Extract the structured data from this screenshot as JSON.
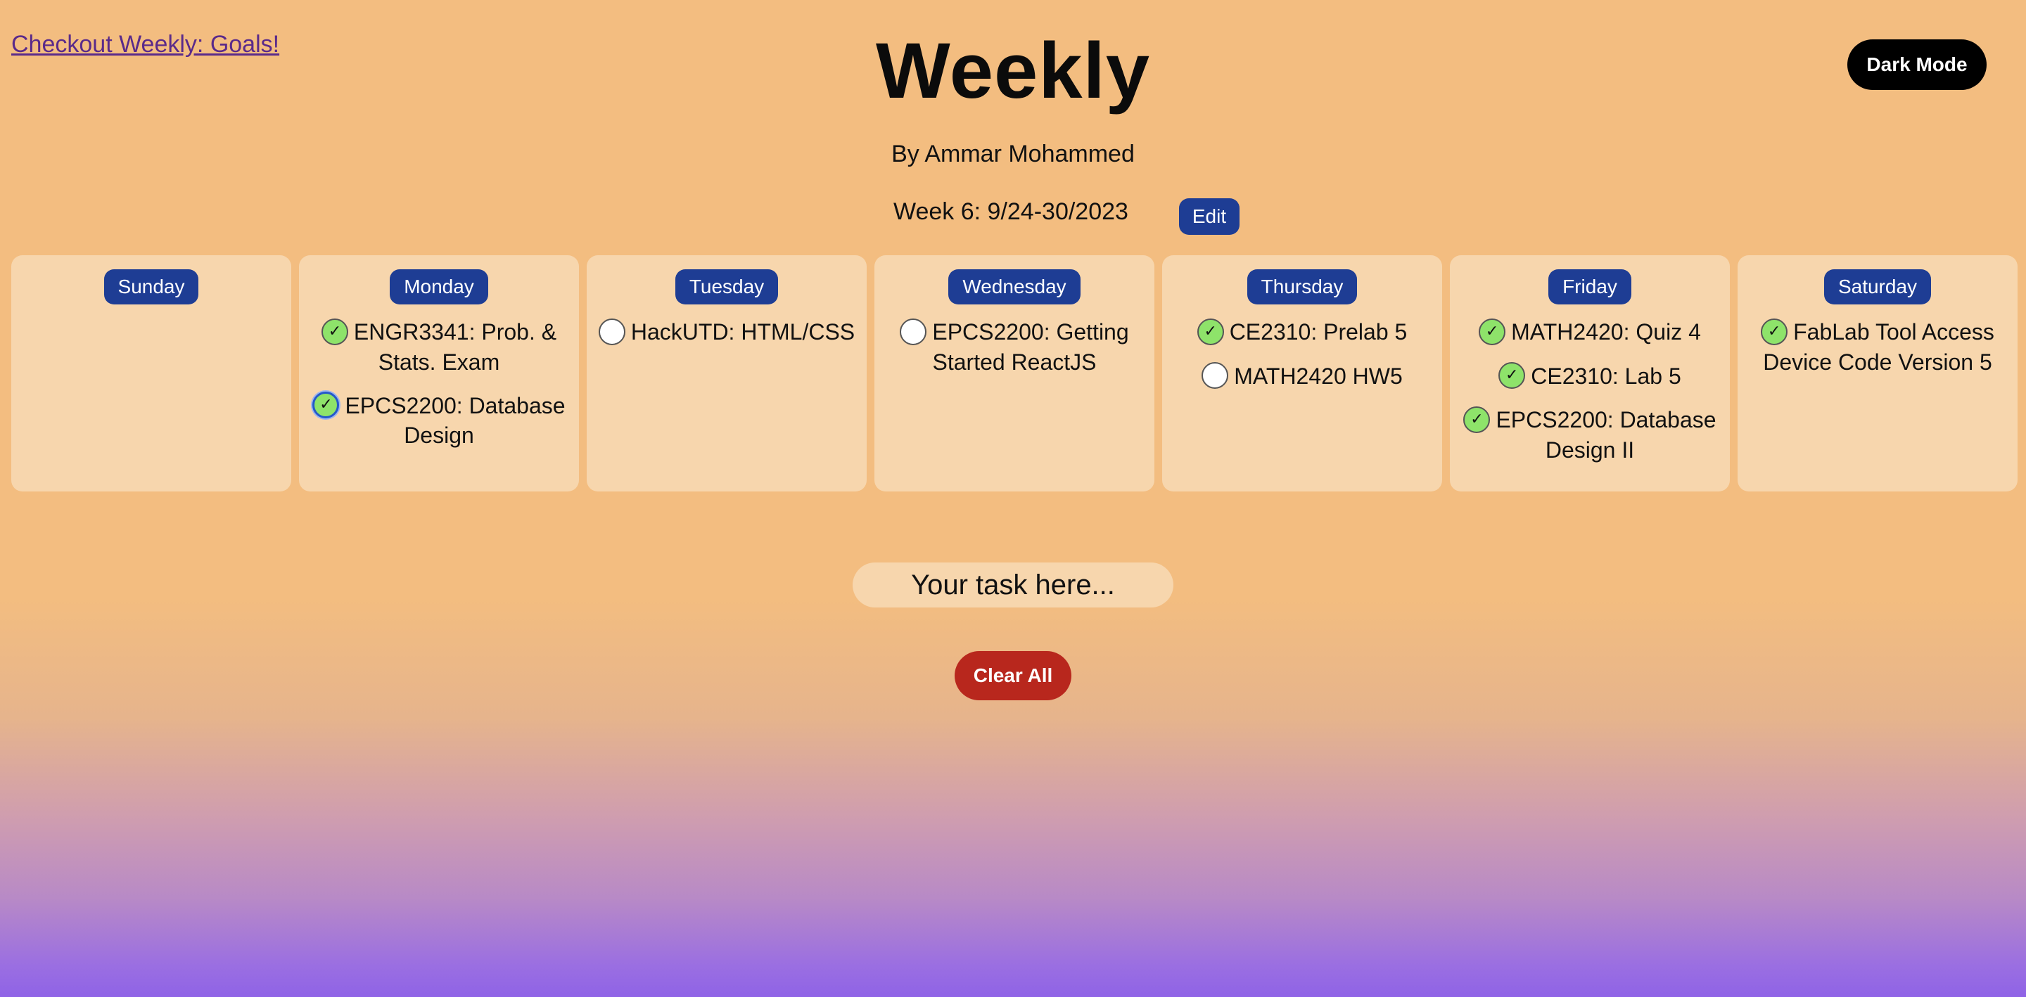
{
  "header": {
    "link_text": "Checkout Weekly: Goals!",
    "title": "Weekly",
    "dark_mode_label": "Dark Mode",
    "byline": "By Ammar Mohammed",
    "week_label": "Week 6: 9/24-30/2023",
    "edit_label": "Edit"
  },
  "days": [
    {
      "name": "Sunday",
      "tasks": []
    },
    {
      "name": "Monday",
      "tasks": [
        {
          "text": "ENGR3341: Prob. & Stats. Exam",
          "done": true
        },
        {
          "text": "EPCS2200: Database Design",
          "done": true,
          "focused": true
        }
      ]
    },
    {
      "name": "Tuesday",
      "tasks": [
        {
          "text": "HackUTD: HTML/CSS",
          "done": false
        }
      ]
    },
    {
      "name": "Wednesday",
      "tasks": [
        {
          "text": "EPCS2200: Getting Started ReactJS",
          "done": false
        }
      ]
    },
    {
      "name": "Thursday",
      "tasks": [
        {
          "text": "CE2310: Prelab 5",
          "done": true
        },
        {
          "text": "MATH2420 HW5",
          "done": false
        }
      ]
    },
    {
      "name": "Friday",
      "tasks": [
        {
          "text": "MATH2420: Quiz 4",
          "done": true
        },
        {
          "text": "CE2310: Lab 5",
          "done": true
        },
        {
          "text": "EPCS2200: Database Design II",
          "done": true
        }
      ]
    },
    {
      "name": "Saturday",
      "tasks": [
        {
          "text": "FabLab Tool Access Device Code Version 5",
          "done": true
        }
      ]
    }
  ],
  "input": {
    "placeholder": "Your task here...",
    "value": ""
  },
  "clear_label": "Clear All",
  "colors": {
    "accent": "#1e3d94",
    "danger": "#b8271d",
    "done_check": "#8ee36a",
    "card": "#f7d6ad",
    "background_top": "#f3bd80",
    "background_bottom": "#8f63e6"
  }
}
